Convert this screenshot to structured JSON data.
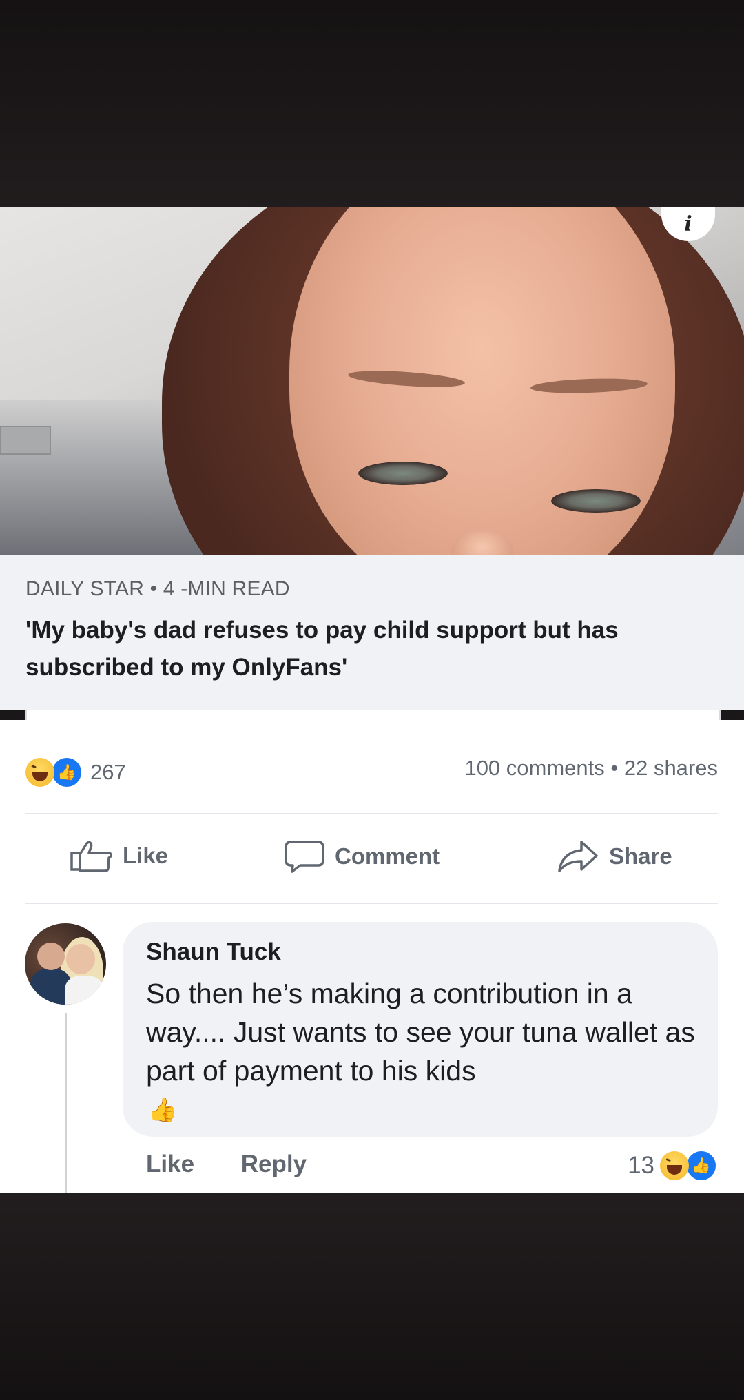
{
  "article": {
    "source": "DAILY STAR • 4 -MIN READ",
    "title": "'My baby's dad refuses to pay child support but has subscribed to my OnlyFans'"
  },
  "post_stats": {
    "reaction_count": "267",
    "comments_shares": "100 comments • 22 shares"
  },
  "actions": {
    "like": "Like",
    "comment": "Comment",
    "share": "Share"
  },
  "comment": {
    "author": "Shaun Tuck",
    "text": "So then he’s making a contribution in a way.... Just wants to see your tuna wallet as part of payment to his kids",
    "emoji": "👍",
    "like_label": "Like",
    "reply_label": "Reply",
    "reaction_count": "13"
  },
  "colors": {
    "facebook_blue": "#1877f2",
    "haha_yellow": "#f5b82b",
    "muted_text": "#606770"
  }
}
